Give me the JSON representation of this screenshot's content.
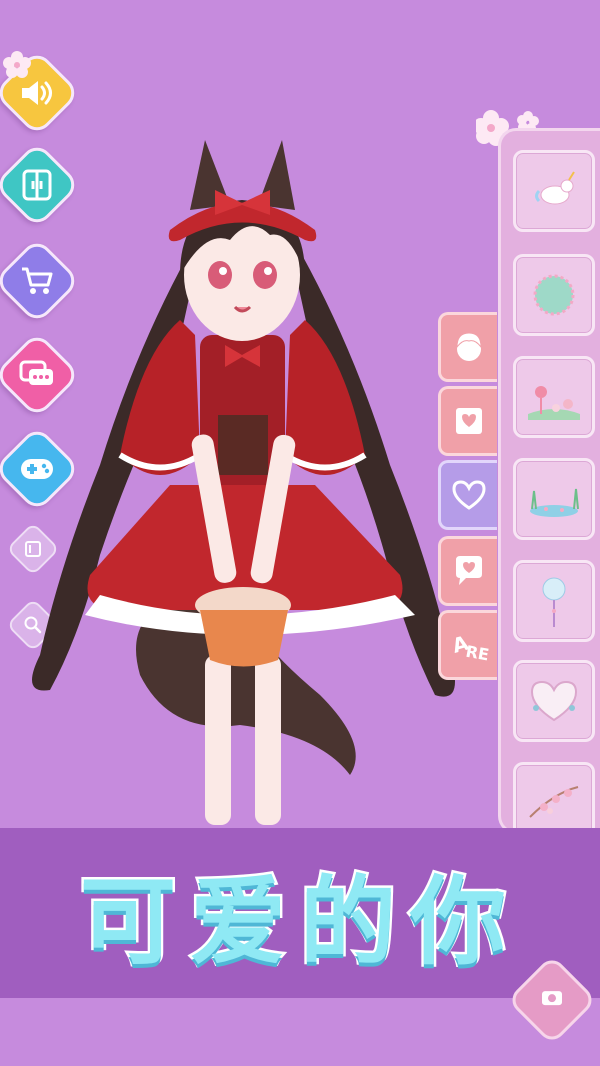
{
  "banner": {
    "title": "可爱的你"
  },
  "left_menu": {
    "items": [
      {
        "name": "sound",
        "icon": "speaker-icon",
        "color": "#f7c63f"
      },
      {
        "name": "wardrobe",
        "icon": "wardrobe-icon",
        "color": "#3fc6c4"
      },
      {
        "name": "shop",
        "icon": "cart-icon",
        "color": "#8f7de8"
      },
      {
        "name": "chat",
        "icon": "chat-bubble-icon",
        "color": "#f05fa6"
      },
      {
        "name": "games",
        "icon": "gamepad-icon",
        "color": "#46b7ee"
      },
      {
        "name": "album",
        "icon": "album-icon",
        "color": "#ffffff"
      },
      {
        "name": "zoom",
        "icon": "magnifier-icon",
        "color": "#ffffff"
      }
    ]
  },
  "category_tabs": [
    {
      "icon": "face-icon",
      "active": false
    },
    {
      "icon": "photo-frame-icon",
      "active": false
    },
    {
      "icon": "heart-icon",
      "active": true
    },
    {
      "icon": "speech-heart-icon",
      "active": false
    },
    {
      "icon": "sticker-text-icon",
      "active": false
    }
  ],
  "background_items": [
    {
      "icon": "unicorn-thumbnail-icon"
    },
    {
      "icon": "green-circle-thumbnail-icon"
    },
    {
      "icon": "flamingo-garden-thumbnail-icon"
    },
    {
      "icon": "pond-thumbnail-icon"
    },
    {
      "icon": "balloon-wand-thumbnail-icon"
    },
    {
      "icon": "heart-frame-thumbnail-icon"
    },
    {
      "icon": "blossom-thumbnail-icon"
    }
  ],
  "colors": {
    "background": "#c68bdd",
    "banner": "#a05ebf",
    "banner_text": "#8fe9f4",
    "panel": "#e3b0df",
    "tab_pink": "#f0a0a8",
    "tab_active": "#b59ce8"
  }
}
